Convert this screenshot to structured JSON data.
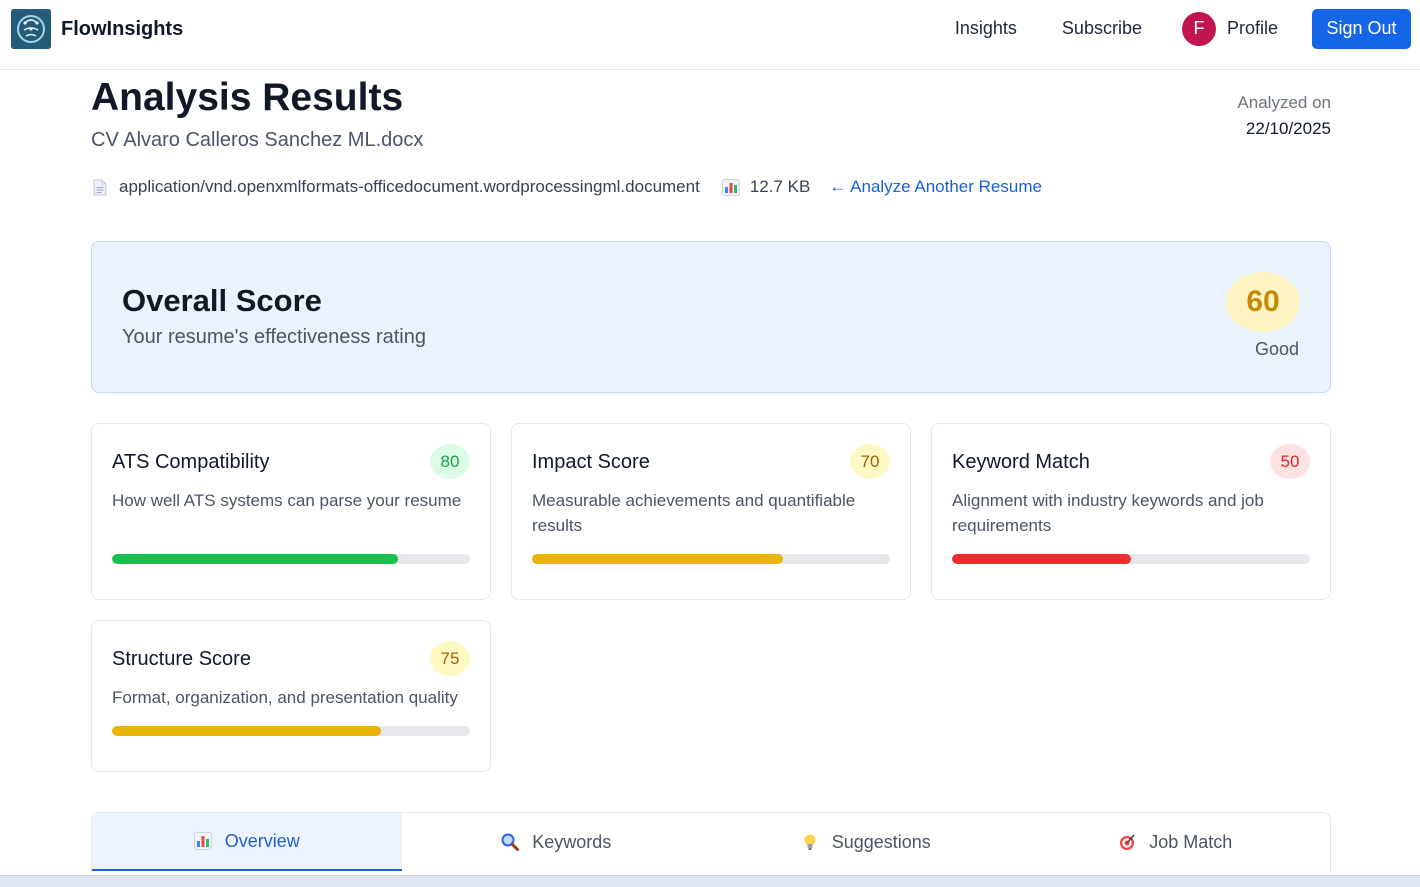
{
  "navbar": {
    "brand": "FlowInsights",
    "links": {
      "insights": "Insights",
      "subscribe": "Subscribe"
    },
    "profile": {
      "initial": "F",
      "label": "Profile"
    },
    "sign_out": "Sign Out"
  },
  "header": {
    "title": "Analysis Results",
    "filename": "CV Alvaro Calleros Sanchez ML.docx",
    "analyzed_label": "Analyzed on",
    "analyzed_date": "22/10/2025",
    "file_type": "application/vnd.openxmlformats-officedocument.wordprocessingml.document",
    "file_size": "12.7 KB",
    "analyze_another": "← Analyze Another Resume"
  },
  "overall": {
    "title": "Overall Score",
    "subtitle": "Your resume's effectiveness rating",
    "score": "60",
    "rating": "Good"
  },
  "cards": [
    {
      "title": "ATS Compatibility",
      "score": "80",
      "progress": 0.8,
      "description": "How well ATS systems can parse your resume",
      "color": "#16c04e",
      "badge_bg": "#dcfce7",
      "badge_fg": "#16a34a"
    },
    {
      "title": "Impact Score",
      "score": "70",
      "progress": 0.7,
      "description": "Measurable achievements and quantifiable results",
      "color": "#eab308",
      "badge_bg": "#fef9c3",
      "badge_fg": "#a16207"
    },
    {
      "title": "Keyword Match",
      "score": "50",
      "progress": 0.5,
      "description": "Alignment with industry keywords and job requirements",
      "color": "#ef2b2b",
      "badge_bg": "#fee2e2",
      "badge_fg": "#dc2626"
    },
    {
      "title": "Structure Score",
      "score": "75",
      "progress": 0.75,
      "description": "Format, organization, and presentation quality",
      "color": "#eab308",
      "badge_bg": "#fef9c3",
      "badge_fg": "#a16207"
    }
  ],
  "tabs": [
    {
      "label": "Overview",
      "icon": "bar-chart-icon",
      "active": true
    },
    {
      "label": "Keywords",
      "icon": "magnifier-icon",
      "active": false
    },
    {
      "label": "Suggestions",
      "icon": "lightbulb-icon",
      "active": false
    },
    {
      "label": "Job Match",
      "icon": "target-icon",
      "active": false
    }
  ]
}
